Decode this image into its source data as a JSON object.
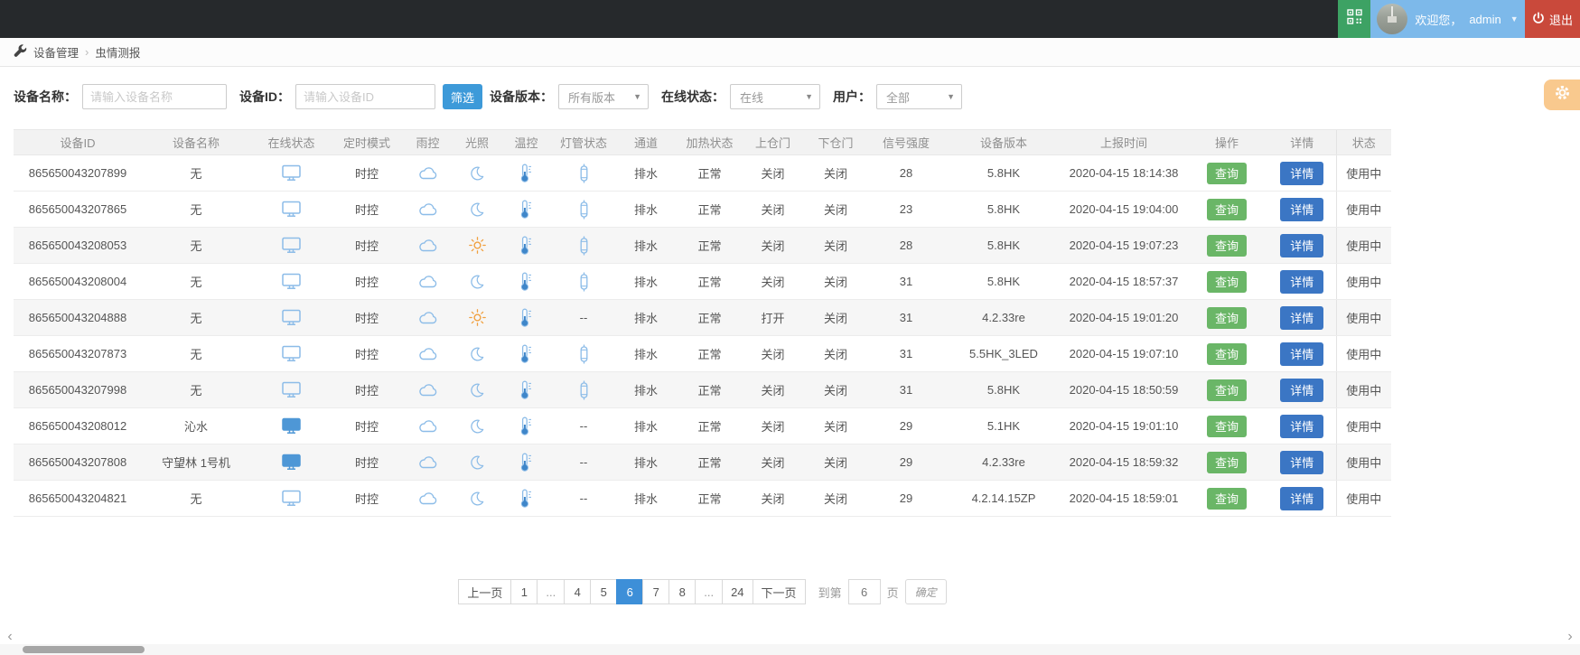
{
  "topbar": {
    "welcome_text": "欢迎您，",
    "username": "admin",
    "logout_label": "退出"
  },
  "breadcrumb": {
    "items": [
      "设备管理",
      "虫情测报"
    ],
    "separator": "›"
  },
  "filters": {
    "device_name_label": "设备名称：",
    "device_name_placeholder": "请输入设备名称",
    "device_id_label": "设备ID：",
    "device_id_placeholder": "请输入设备ID",
    "filter_button": "筛选",
    "version_label": "设备版本：",
    "version_value": "所有版本",
    "online_label": "在线状态：",
    "online_value": "在线",
    "user_label": "用户：",
    "user_value": "全部"
  },
  "table": {
    "headers": [
      "设备ID",
      "设备名称",
      "在线状态",
      "定时模式",
      "雨控",
      "光照",
      "温控",
      "灯管状态",
      "通道",
      "加热状态",
      "上仓门",
      "下仓门",
      "信号强度",
      "设备版本",
      "上报时间",
      "操作",
      "详情",
      "状态"
    ],
    "query_label": "查询",
    "detail_label": "详情",
    "rows": [
      {
        "device_id": "865650043207899",
        "name": "无",
        "online_icon": "monitor-outline",
        "timer_mode": "时控",
        "rain_icon": "cloud",
        "light_icon": "moon",
        "temp_icon": "thermometer",
        "lamp_icon": "lamp-tube",
        "channel": "排水",
        "heating": "正常",
        "upper_door": "关闭",
        "lower_door": "关闭",
        "signal": "28",
        "version": "5.8HK",
        "report_time": "2020-04-15 18:14:38",
        "status": "使用中"
      },
      {
        "device_id": "865650043207865",
        "name": "无",
        "online_icon": "monitor-outline",
        "timer_mode": "时控",
        "rain_icon": "cloud",
        "light_icon": "moon",
        "temp_icon": "thermometer",
        "lamp_icon": "lamp-tube",
        "channel": "排水",
        "heating": "正常",
        "upper_door": "关闭",
        "lower_door": "关闭",
        "signal": "23",
        "version": "5.8HK",
        "report_time": "2020-04-15 19:04:00",
        "status": "使用中"
      },
      {
        "device_id": "865650043208053",
        "name": "无",
        "online_icon": "monitor-outline",
        "timer_mode": "时控",
        "rain_icon": "cloud",
        "light_icon": "sun",
        "temp_icon": "thermometer",
        "lamp_icon": "lamp-tube",
        "channel": "排水",
        "heating": "正常",
        "upper_door": "关闭",
        "lower_door": "关闭",
        "signal": "28",
        "version": "5.8HK",
        "report_time": "2020-04-15 19:07:23",
        "status": "使用中"
      },
      {
        "device_id": "865650043208004",
        "name": "无",
        "online_icon": "monitor-outline",
        "timer_mode": "时控",
        "rain_icon": "cloud",
        "light_icon": "moon",
        "temp_icon": "thermometer",
        "lamp_icon": "lamp-tube",
        "channel": "排水",
        "heating": "正常",
        "upper_door": "关闭",
        "lower_door": "关闭",
        "signal": "31",
        "version": "5.8HK",
        "report_time": "2020-04-15 18:57:37",
        "status": "使用中"
      },
      {
        "device_id": "865650043204888",
        "name": "无",
        "online_icon": "monitor-outline",
        "timer_mode": "时控",
        "rain_icon": "cloud",
        "light_icon": "sun",
        "temp_icon": "thermometer",
        "lamp_icon": "--",
        "channel": "排水",
        "heating": "正常",
        "upper_door": "打开",
        "lower_door": "关闭",
        "signal": "31",
        "version": "4.2.33re",
        "report_time": "2020-04-15 19:01:20",
        "status": "使用中"
      },
      {
        "device_id": "865650043207873",
        "name": "无",
        "online_icon": "monitor-outline",
        "timer_mode": "时控",
        "rain_icon": "cloud",
        "light_icon": "moon",
        "temp_icon": "thermometer",
        "lamp_icon": "lamp-tube",
        "channel": "排水",
        "heating": "正常",
        "upper_door": "关闭",
        "lower_door": "关闭",
        "signal": "31",
        "version": "5.5HK_3LED",
        "report_time": "2020-04-15 19:07:10",
        "status": "使用中"
      },
      {
        "device_id": "865650043207998",
        "name": "无",
        "online_icon": "monitor-outline",
        "timer_mode": "时控",
        "rain_icon": "cloud",
        "light_icon": "moon",
        "temp_icon": "thermometer",
        "lamp_icon": "lamp-tube",
        "channel": "排水",
        "heating": "正常",
        "upper_door": "关闭",
        "lower_door": "关闭",
        "signal": "31",
        "version": "5.8HK",
        "report_time": "2020-04-15 18:50:59",
        "status": "使用中"
      },
      {
        "device_id": "865650043208012",
        "name": "沁水",
        "online_icon": "monitor-solid",
        "timer_mode": "时控",
        "rain_icon": "cloud",
        "light_icon": "moon",
        "temp_icon": "thermometer",
        "lamp_icon": "--",
        "channel": "排水",
        "heating": "正常",
        "upper_door": "关闭",
        "lower_door": "关闭",
        "signal": "29",
        "version": "5.1HK",
        "report_time": "2020-04-15 19:01:10",
        "status": "使用中"
      },
      {
        "device_id": "865650043207808",
        "name": "守望林 1号机",
        "online_icon": "monitor-solid",
        "timer_mode": "时控",
        "rain_icon": "cloud",
        "light_icon": "moon",
        "temp_icon": "thermometer",
        "lamp_icon": "--",
        "channel": "排水",
        "heating": "正常",
        "upper_door": "关闭",
        "lower_door": "关闭",
        "signal": "29",
        "version": "4.2.33re",
        "report_time": "2020-04-15 18:59:32",
        "status": "使用中"
      },
      {
        "device_id": "865650043204821",
        "name": "无",
        "online_icon": "monitor-outline",
        "timer_mode": "时控",
        "rain_icon": "cloud",
        "light_icon": "moon",
        "temp_icon": "thermometer",
        "lamp_icon": "--",
        "channel": "排水",
        "heating": "正常",
        "upper_door": "关闭",
        "lower_door": "关闭",
        "signal": "29",
        "version": "4.2.14.15ZP",
        "report_time": "2020-04-15 18:59:01",
        "status": "使用中"
      }
    ]
  },
  "pagination": {
    "prev": "上一页",
    "next": "下一页",
    "pages": [
      "1",
      "...",
      "4",
      "5",
      "6",
      "7",
      "8",
      "...",
      "24"
    ],
    "active": "6",
    "goto_label": "到第",
    "goto_value": "6",
    "page_unit": "页",
    "confirm": "确定"
  },
  "colors": {
    "topbar_bg": "#26292c",
    "qr_green": "#3da264",
    "user_blue": "#7db9ea",
    "logout_red": "#c9493b",
    "filter_blue": "#3d9ad9",
    "query_green": "#6ab667",
    "detail_blue": "#3b76c4",
    "active_page_blue": "#3d8fd8",
    "gear_orange": "#f9c98e",
    "icon_blue": "#8cbce8"
  }
}
